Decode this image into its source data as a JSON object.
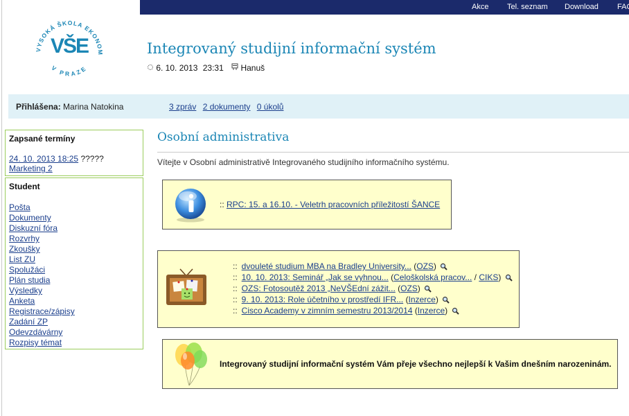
{
  "topnav": {
    "items": [
      "Akce",
      "Tel. seznam",
      "Download",
      "FAQ"
    ]
  },
  "logo": {
    "arc_text": "VYSOKÁ ŠKOLA EKONOMICKÁ",
    "bottom_text": "V PRAZE",
    "mark": "VŠE"
  },
  "header": {
    "title": "Integrovaný studijní informační systém",
    "date": "6. 10. 2013",
    "time": "23:31",
    "nameday": "Hanuš"
  },
  "userbar": {
    "label": "Přihlášena:",
    "name": "Marina Natokina",
    "messages": "3 zpráv",
    "documents": "2 dokumenty",
    "tasks": "0 úkolů"
  },
  "terms_box": {
    "title": "Zapsané termíny",
    "date_link": "24. 10. 2013 18:25",
    "status": "?????",
    "course_link": "Marketing 2"
  },
  "student_box": {
    "title": "Student",
    "items": [
      "Pošta",
      "Dokumenty",
      "Diskuzní fóra",
      "Rozvrhy",
      "Zkoušky",
      "List ZU",
      "Spolužáci",
      "Plán studia",
      "Výsledky",
      "Anketa",
      "Registrace/zápisy",
      "Zadání ZP",
      "Odevzdávárny",
      "Rozpisy témat"
    ]
  },
  "main": {
    "title": "Osobní administrativa",
    "intro": "Vítejte v Osobní administrativě Integrovaného studijního informačního systému.",
    "info_link": "RPC: 15. a 16.10. - Veletrh pracovních příležitostí ŠANCE",
    "news": [
      {
        "text": "dvouleté studium MBA na Bradley University...",
        "src": [
          "OZS"
        ]
      },
      {
        "text": "10. 10. 2013: Seminář „Jak se vyhnou...",
        "src": [
          "Celoškolská pracov...",
          "CIKS"
        ]
      },
      {
        "text": "OZS: Fotosoutěž 2013 „NeVŠEdní zážit...",
        "src": [
          "OZS"
        ]
      },
      {
        "text": "9. 10. 2013: Role účetního v prostředí IFR...",
        "src": [
          "Inzerce"
        ]
      },
      {
        "text": "Cisco Academy v zimním semestru 2013/2014",
        "src": [
          "Inzerce"
        ]
      }
    ],
    "birthday": "Integrovaný studijní informační systém Vám přeje všechno nejlepší k Vašim dnešním narozeninám."
  },
  "colors": {
    "topbar": "#1b2a6b",
    "title": "#1b86b5",
    "userbar_bg": "#e0f1f7",
    "box_border": "#9acc5c",
    "notice_bg": "#ffffcc",
    "link": "#1a3e8c"
  }
}
